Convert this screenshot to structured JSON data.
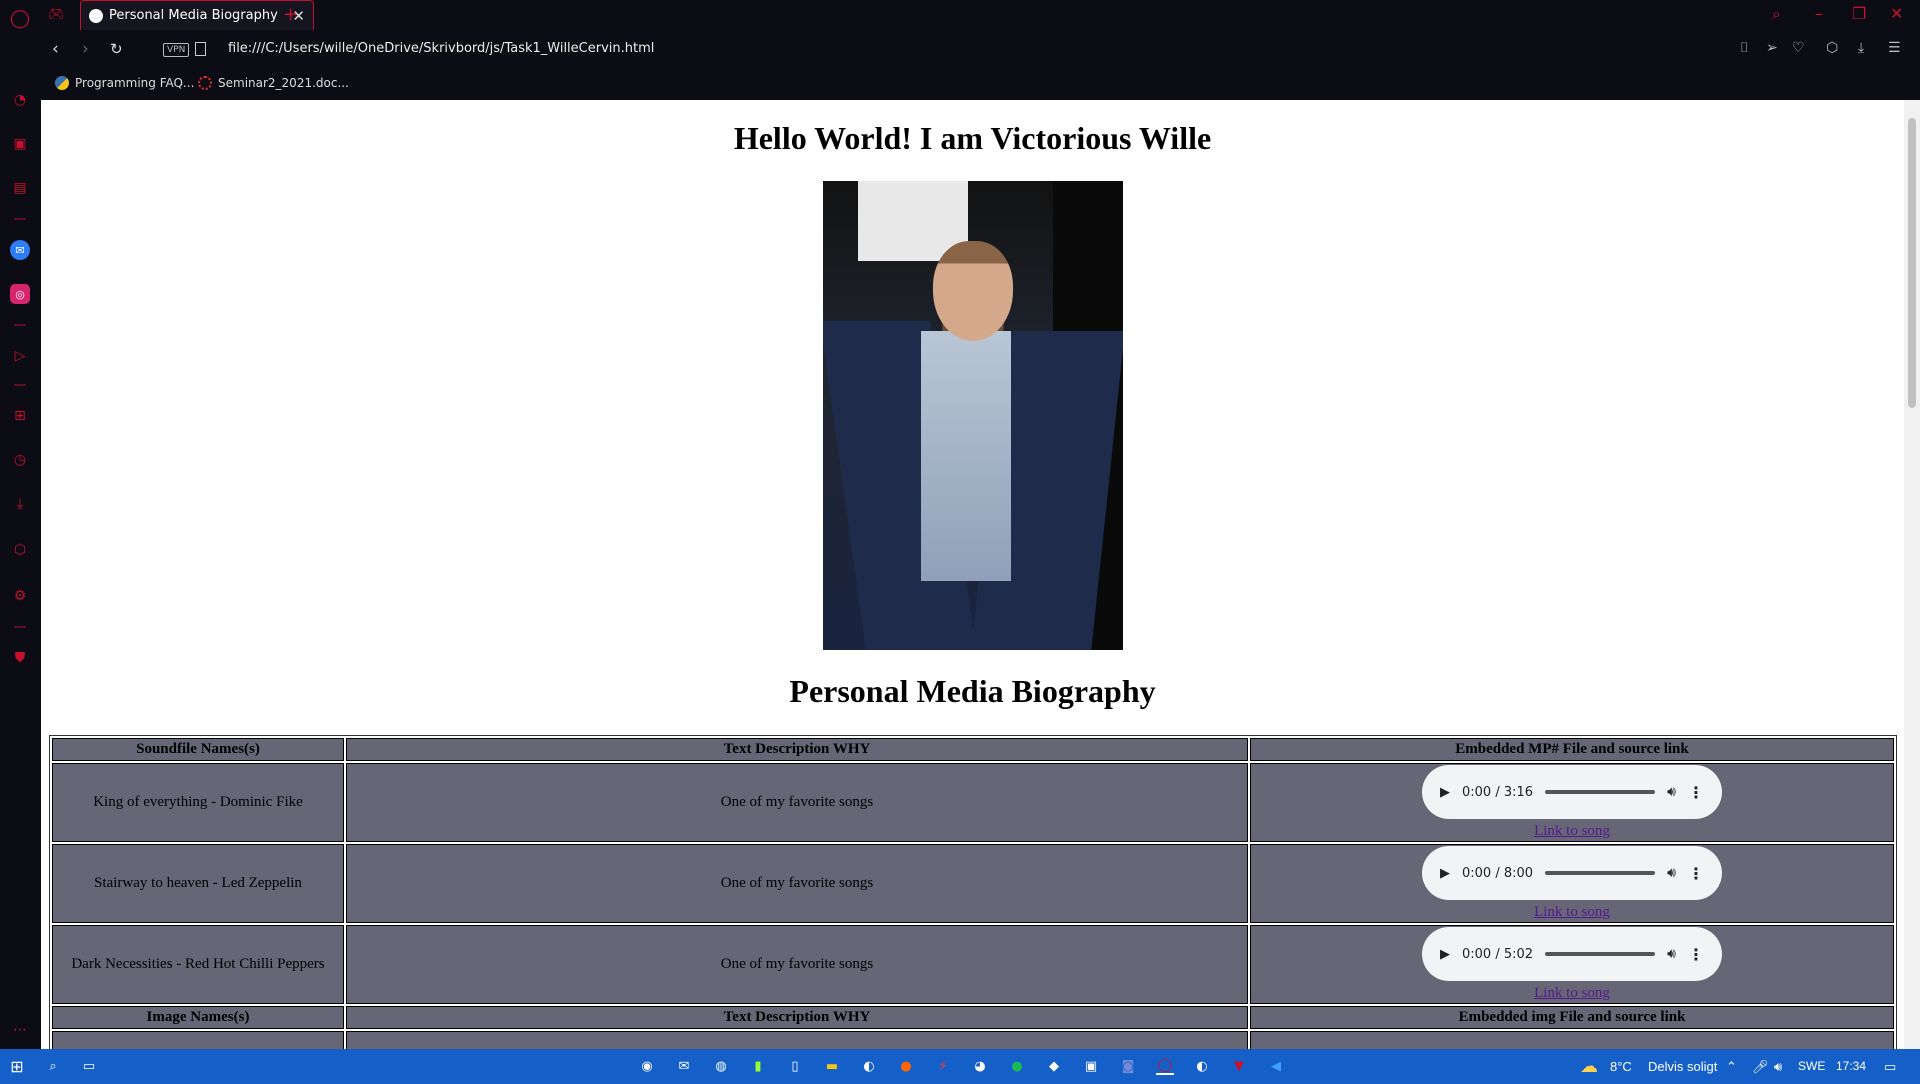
{
  "browser": {
    "tab_title": "Personal Media Biography",
    "new_tab": "+",
    "close_tab": "✕",
    "url": "file:///C:/Users/wille/OneDrive/Skrivbord/js/Task1_WilleCervin.html",
    "vpn_label": "VPN",
    "bookmarks": [
      {
        "label": "Programming FAQ..."
      },
      {
        "label": "Seminar2_2021.doc..."
      }
    ]
  },
  "page": {
    "heading": "Hello World! I am Victorious Wille",
    "subheading": "Personal Media Biography",
    "audio_table": {
      "headers": [
        "Soundfile Names(s)",
        "Text Description WHY",
        "Embedded MP# File and source link"
      ],
      "rows": [
        {
          "name": "King of everything - Dominic Fike",
          "desc": "One of my favorite songs",
          "time": "0:00 / 3:16",
          "link": "Link to song"
        },
        {
          "name": "Stairway to heaven - Led Zeppelin",
          "desc": "One of my favorite songs",
          "time": "0:00 / 8:00",
          "link": "Link to song"
        },
        {
          "name": "Dark Necessities - Red Hot Chilli Peppers",
          "desc": "One of my favorite songs",
          "time": "0:00 / 5:02",
          "link": "Link to song"
        }
      ]
    },
    "image_table": {
      "headers": [
        "Image Names(s)",
        "Text Description WHY",
        "Embedded img File and source link"
      ]
    }
  },
  "taskbar": {
    "temperature": "8°C",
    "weather": "Delvis soligt",
    "language": "SWE",
    "time": "17:34"
  },
  "colors": {
    "accent": "#c8102e",
    "table_cell": "#666677",
    "taskbar": "#1560c8"
  }
}
